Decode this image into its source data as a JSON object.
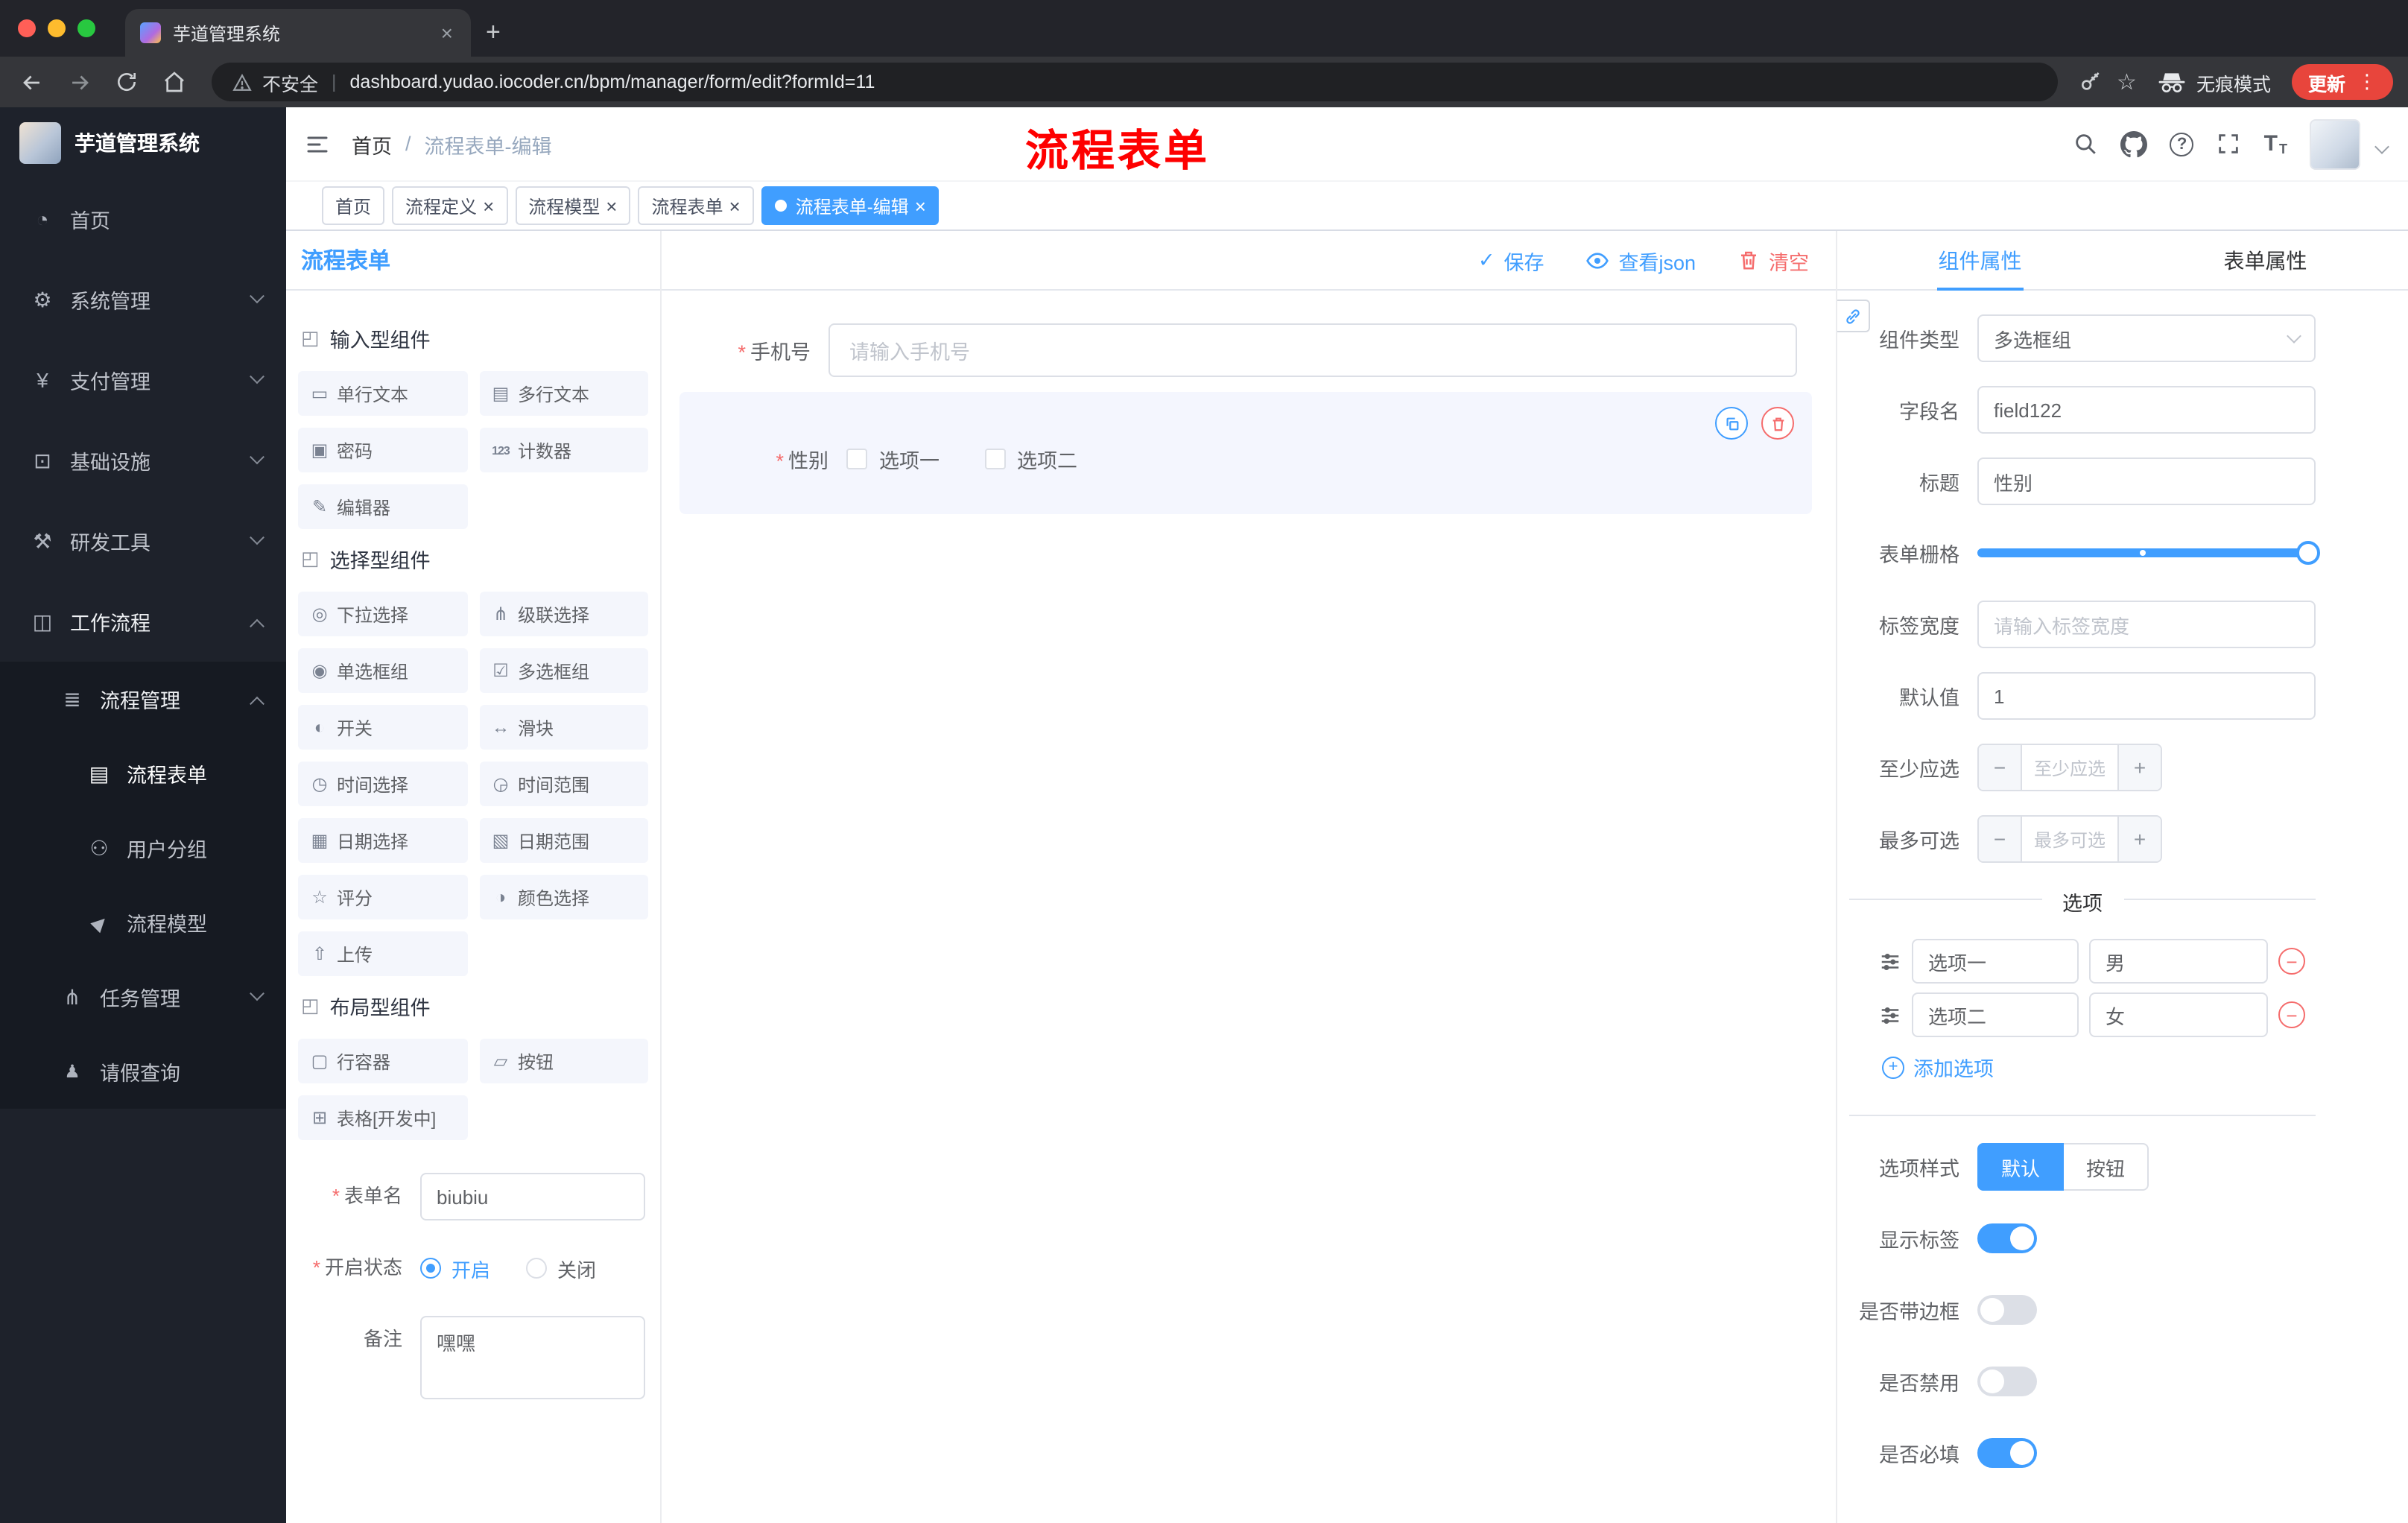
{
  "icons": {
    "cube": "◰",
    "check": "✓",
    "close": "×",
    "plus": "+",
    "dots": "⋮",
    "star": "☆",
    "minus": "−",
    "question": "?",
    "font_large": "T",
    "font_small": "T"
  },
  "browser": {
    "tab_title": "芋道管理系统",
    "security_label": "不安全",
    "url": "dashboard.yudao.iocoder.cn/bpm/manager/form/edit?formId=11",
    "incognito_label": "无痕模式",
    "update_label": "更新"
  },
  "sidebar": {
    "logo_title": "芋道管理系统",
    "menu": [
      {
        "label": "首页",
        "icon": "◔",
        "cls": "lvl1",
        "chev": "",
        "iconcls": ""
      },
      {
        "label": "系统管理",
        "icon": "⚙",
        "cls": "lvl1",
        "chev": "down",
        "iconcls": ""
      },
      {
        "label": "支付管理",
        "icon": "¥",
        "cls": "lvl1",
        "chev": "down",
        "iconcls": ""
      },
      {
        "label": "基础设施",
        "icon": "⊡",
        "cls": "lvl1",
        "chev": "down",
        "iconcls": ""
      },
      {
        "label": "研发工具",
        "icon": "⚒",
        "cls": "lvl1",
        "chev": "down",
        "iconcls": ""
      },
      {
        "label": "工作流程",
        "icon": "◫",
        "cls": "lvl1 lit",
        "chev": "up",
        "iconcls": ""
      },
      {
        "label": "流程管理",
        "icon": "≣",
        "cls": "lvl2 sub lit",
        "chev": "up",
        "iconcls": ""
      },
      {
        "label": "流程表单",
        "icon": "▤",
        "cls": "lvl3 sub active",
        "chev": "",
        "iconcls": ""
      },
      {
        "label": "用户分组",
        "icon": "⚇",
        "cls": "lvl3 sub",
        "chev": "",
        "iconcls": ""
      },
      {
        "label": "流程模型",
        "icon": "▶",
        "cls": "lvl3 sub",
        "chev": "",
        "iconcls": "rot"
      },
      {
        "label": "任务管理",
        "icon": "⋔",
        "cls": "lvl2 sub",
        "chev": "down",
        "iconcls": ""
      },
      {
        "label": "请假查询",
        "icon": "♟",
        "cls": "lvl2 sub",
        "chev": "",
        "iconcls": "small"
      }
    ]
  },
  "header": {
    "breadcrumb_home": "首页",
    "breadcrumb_sep": "/",
    "breadcrumb_current": "流程表单-编辑",
    "annotation": "流程表单"
  },
  "tagbar": {
    "tags": [
      {
        "label": "首页",
        "cls": "",
        "xcls": ""
      },
      {
        "label": "流程定义",
        "cls": "",
        "xcls": "show"
      },
      {
        "label": "流程模型",
        "cls": "",
        "xcls": "show"
      },
      {
        "label": "流程表单",
        "cls": "",
        "xcls": "show"
      },
      {
        "label": "流程表单-编辑",
        "cls": "active",
        "xcls": "show"
      }
    ]
  },
  "designer": {
    "panel_title": "流程表单",
    "actions": {
      "save": "保存",
      "view_json": "查看json",
      "clear": "清空"
    },
    "palette_sections": [
      {
        "title": "输入型组件",
        "items": [
          {
            "icon": "▭",
            "label": "单行文本",
            "iconcls": ""
          },
          {
            "icon": "▤",
            "label": "多行文本",
            "iconcls": ""
          },
          {
            "icon": "▣",
            "label": "密码",
            "iconcls": ""
          },
          {
            "icon": "123",
            "label": "计数器",
            "iconcls": "txt"
          },
          {
            "icon": "✎",
            "label": "编辑器",
            "iconcls": ""
          }
        ]
      },
      {
        "title": "选择型组件",
        "items": [
          {
            "icon": "◎",
            "label": "下拉选择",
            "iconcls": ""
          },
          {
            "icon": "⋔",
            "label": "级联选择",
            "iconcls": ""
          },
          {
            "icon": "◉",
            "label": "单选框组",
            "iconcls": ""
          },
          {
            "icon": "☑",
            "label": "多选框组",
            "iconcls": ""
          },
          {
            "icon": "◐",
            "label": "开关",
            "iconcls": ""
          },
          {
            "icon": "↔",
            "label": "滑块",
            "iconcls": ""
          },
          {
            "icon": "◷",
            "label": "时间选择",
            "iconcls": ""
          },
          {
            "icon": "◶",
            "label": "时间范围",
            "iconcls": ""
          },
          {
            "icon": "▦",
            "label": "日期选择",
            "iconcls": ""
          },
          {
            "icon": "▧",
            "label": "日期范围",
            "iconcls": ""
          },
          {
            "icon": "☆",
            "label": "评分",
            "iconcls": ""
          },
          {
            "icon": "◑",
            "label": "颜色选择",
            "iconcls": ""
          },
          {
            "icon": "⇧",
            "label": "上传",
            "iconcls": ""
          }
        ]
      },
      {
        "title": "布局型组件",
        "items": [
          {
            "icon": "▢",
            "label": "行容器",
            "iconcls": ""
          },
          {
            "icon": "▱",
            "label": "按钮",
            "iconcls": ""
          },
          {
            "icon": "⊞",
            "label": "表格[开发中]",
            "iconcls": ""
          }
        ]
      }
    ],
    "meta_form": {
      "name_label": "表单名",
      "name_value": "biubiu",
      "status_label": "开启状态",
      "status_on": "开启",
      "status_off": "关闭",
      "remark_label": "备注",
      "remark_value": "嘿嘿"
    },
    "canvas": {
      "phone_label": "手机号",
      "phone_placeholder": "请输入手机号",
      "gender_label": "性别",
      "gender_options": [
        {
          "label": "选项一"
        },
        {
          "label": "选项二"
        }
      ]
    }
  },
  "props": {
    "tab_component": "组件属性",
    "tab_form": "表单属性",
    "rows": {
      "type_label": "组件类型",
      "type_value": "多选框组",
      "field_label": "字段名",
      "field_value": "field122",
      "title_label": "标题",
      "title_value": "性别",
      "grid_label": "表单栅格",
      "width_label": "标签宽度",
      "width_placeholder": "请输入标签宽度",
      "default_label": "默认值",
      "default_value": "1",
      "min_label": "至少应选",
      "min_placeholder": "至少应选",
      "max_label": "最多可选",
      "max_placeholder": "最多可选"
    },
    "options_divider": "选项",
    "options": [
      {
        "name": "选项一",
        "value": "男"
      },
      {
        "name": "选项二",
        "value": "女"
      }
    ],
    "add_option": "添加选项",
    "style_label": "选项样式",
    "style_default": "默认",
    "style_button": "按钮",
    "switches": [
      {
        "label": "显示标签",
        "on": "on"
      },
      {
        "label": "是否带边框",
        "on": ""
      },
      {
        "label": "是否禁用",
        "on": ""
      },
      {
        "label": "是否必填",
        "on": "on"
      }
    ]
  }
}
